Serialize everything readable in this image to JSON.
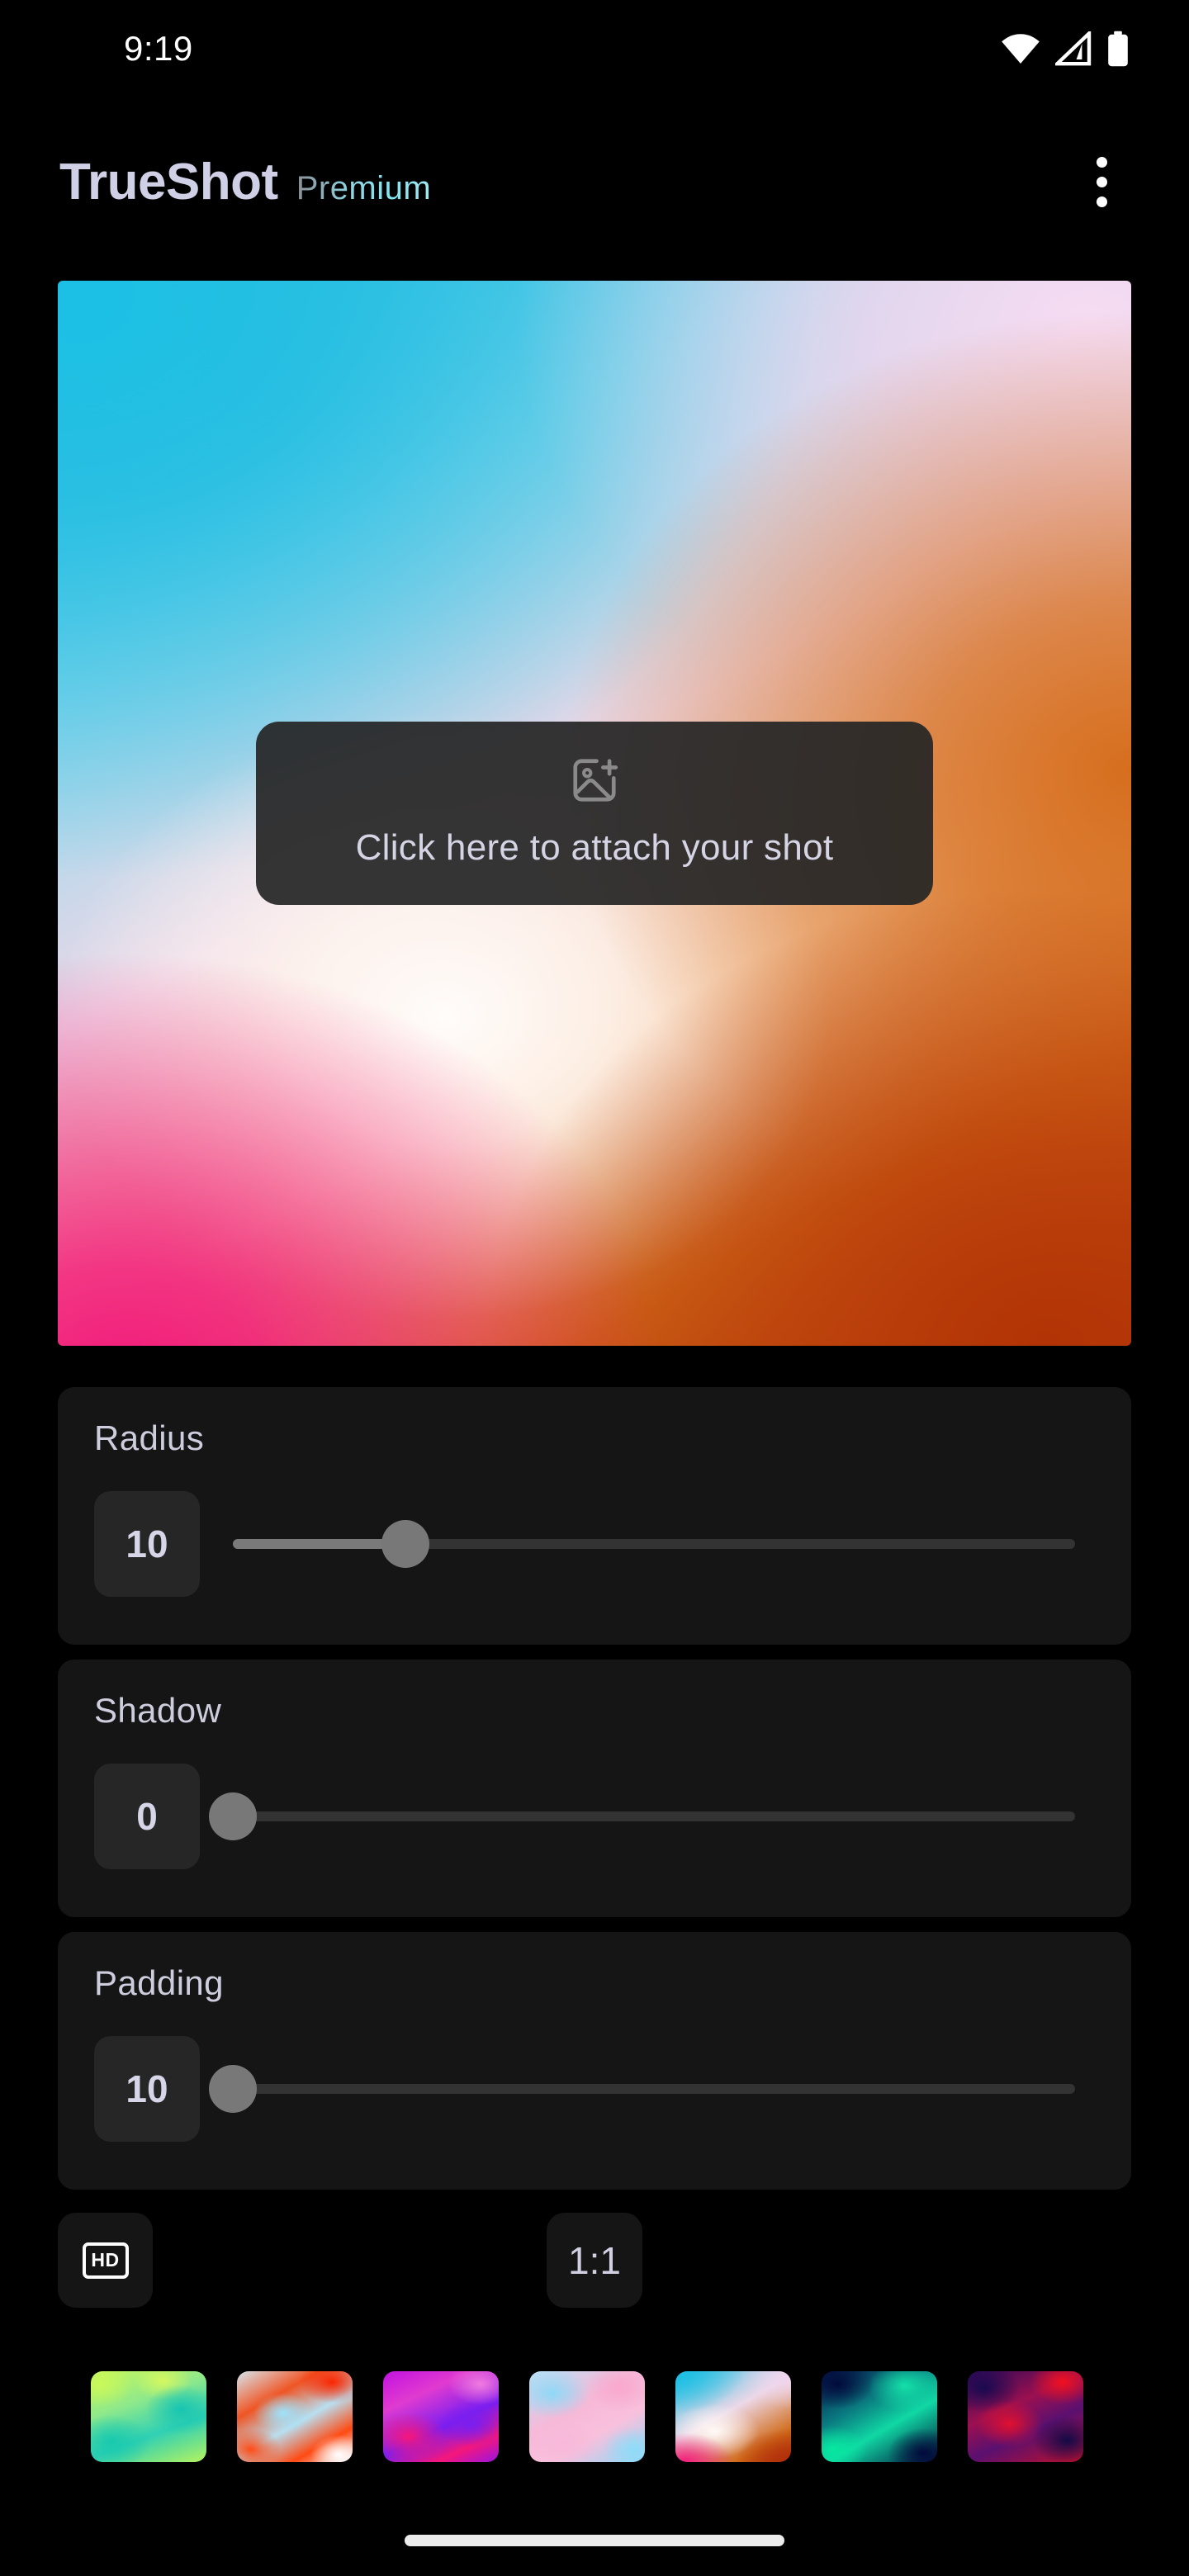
{
  "statusbar": {
    "time": "9:19",
    "icons": [
      "wifi-icon",
      "cellular-signal-icon",
      "battery-icon"
    ]
  },
  "appbar": {
    "title": "TrueShot",
    "subtitle": "Premium",
    "overflow_menu": "more-options-icon"
  },
  "preview": {
    "attach_label": "Click here to attach your shot",
    "attach_icon": "add-image-icon",
    "gradient_name": "cyan-pink-orange",
    "colors": {
      "top_left": "#1BC0E4",
      "top_right": "#F0D6EE",
      "center": "#FFF6F0",
      "bottom_left": "#F21C7C",
      "bottom_right": "#B2300A"
    }
  },
  "controls": [
    {
      "label": "Radius",
      "value": "10",
      "percent": 20
    },
    {
      "label": "Shadow",
      "value": "0",
      "percent": 0
    },
    {
      "label": "Padding",
      "value": "10",
      "percent": 0
    }
  ],
  "actions": {
    "quality_label": "HD",
    "quality_icon": "hd-icon",
    "ratio_label": "1:1"
  },
  "swatches": [
    {
      "name": "lime-teal",
      "selected": false,
      "css": "radial-gradient(58% 52% at 18% 78%, #18c9ae 0%, rgba(24,201,174,0) 58%), radial-gradient(52% 46% at 78% 42%, #17c5b2 0%, rgba(23,197,178,0) 60%), radial-gradient(46% 40% at 62% 10%, #d4f760 0%, rgba(212,247,96,0) 55%), radial-gradient(50% 44% at 8% 14%, #c9f85a 0%, rgba(201,248,90,0) 58%), linear-gradient(160deg, #c8f75c 0%, #8fe98a 35%, #2fd0b4 65%, #b6f35e 100%)"
    },
    {
      "name": "red-ice",
      "selected": false,
      "css": "radial-gradient(52% 42% at 82% 12%, #fa2600 0%, rgba(250,38,0,0) 55%), radial-gradient(46% 40% at 12% 86%, #ff4b14 0%, rgba(255,75,20,0) 58%), radial-gradient(44% 38% at 40% 46%, #9fe2fb 0%, rgba(159,226,251,0) 58%), radial-gradient(42% 38% at 88% 92%, #ffffff 0%, rgba(255,255,255,0) 58%), linear-gradient(150deg, #d7e6ee 0%, #ef5524 30%, #b9dff0 55%, #ff4a12 78%, #f4f7f8 100%)"
    },
    {
      "name": "magenta-violet",
      "selected": false,
      "css": "radial-gradient(56% 46% at 22% 72%, #f5177a 0%, rgba(245,23,122,0) 58%), radial-gradient(50% 44% at 76% 58%, #7a1ef0 0%, rgba(122,30,240,0) 58%), radial-gradient(48% 40% at 84% 14%, #f07be0 0%, rgba(240,123,224,0) 58%), linear-gradient(155deg, #c112e0 0%, #e03bd0 28%, #7a1ef0 58%, #f5177a 80%, #9a14e2 100%)"
    },
    {
      "name": "pink-sky",
      "selected": false,
      "css": "radial-gradient(56% 48% at 20% 24%, #8fd9f7 0%, rgba(143,217,247,0) 58%), radial-gradient(52% 46% at 78% 18%, #f9a8cd 0%, rgba(249,168,205,0) 58%), radial-gradient(50% 44% at 30% 80%, #f8b8da 0%, rgba(248,184,218,0) 58%), radial-gradient(46% 42% at 90% 86%, #8edcf8 0%, rgba(142,220,248,0) 58%), linear-gradient(150deg, #b9e2f6 0%, #f6b9d8 40%, #f9c0dc 65%, #8fd9f7 100%)"
    },
    {
      "name": "cyan-pink-orange",
      "selected": true,
      "css": "radial-gradient(82% 62% at 8% 100%, #f21c7c 0%, rgba(242,28,124,0) 52%), radial-gradient(78% 62% at 96% 98%, #b2300a 0%, rgba(178,48,10,0) 56%), radial-gradient(64% 50% at 34% 66%, #fffaf6 0%, rgba(255,250,246,0) 60%), radial-gradient(72% 58% at 98% 6%, #f0d6ee 0%, rgba(240,214,238,0) 60%), radial-gradient(88% 70% at 2% 2%, #1bc0e4 0%, rgba(27,192,228,0) 64%), linear-gradient(150deg, #27bfe3 0%, #ecd8e8 45%, #d06a18 80%, #b2300a 100%)"
    },
    {
      "name": "navy-emerald",
      "selected": false,
      "css": "radial-gradient(54% 48% at 72% 16%, #13e0a8 0%, rgba(19,224,168,0) 58%), radial-gradient(50% 44% at 10% 86%, #07e8a0 0%, rgba(7,232,160,0) 58%), radial-gradient(52% 46% at 14% 14%, #020a3c 0%, rgba(2,10,60,0) 60%), radial-gradient(52% 46% at 88% 90%, #020a3c 0%, rgba(2,10,60,0) 60%), linear-gradient(150deg, #041045 0%, #0a7a80 35%, #10d8a4 60%, #031038 100%)"
    },
    {
      "name": "indigo-crimson",
      "selected": false,
      "css": "radial-gradient(50% 44% at 82% 12%, #f01020 0%, rgba(240,16,32,0) 56%), radial-gradient(52% 46% at 36% 58%, #e01030 0%, rgba(224,16,48,0) 56%), radial-gradient(52% 46% at 14% 18%, #1a0a50 0%, rgba(26,10,80,0) 60%), radial-gradient(50% 44% at 86% 76%, #120a46 0%, rgba(18,10,70,0) 60%), linear-gradient(155deg, #2a0a58 0%, #9b1050 38%, #5a1070 62%, #c0102a 100%)"
    }
  ]
}
